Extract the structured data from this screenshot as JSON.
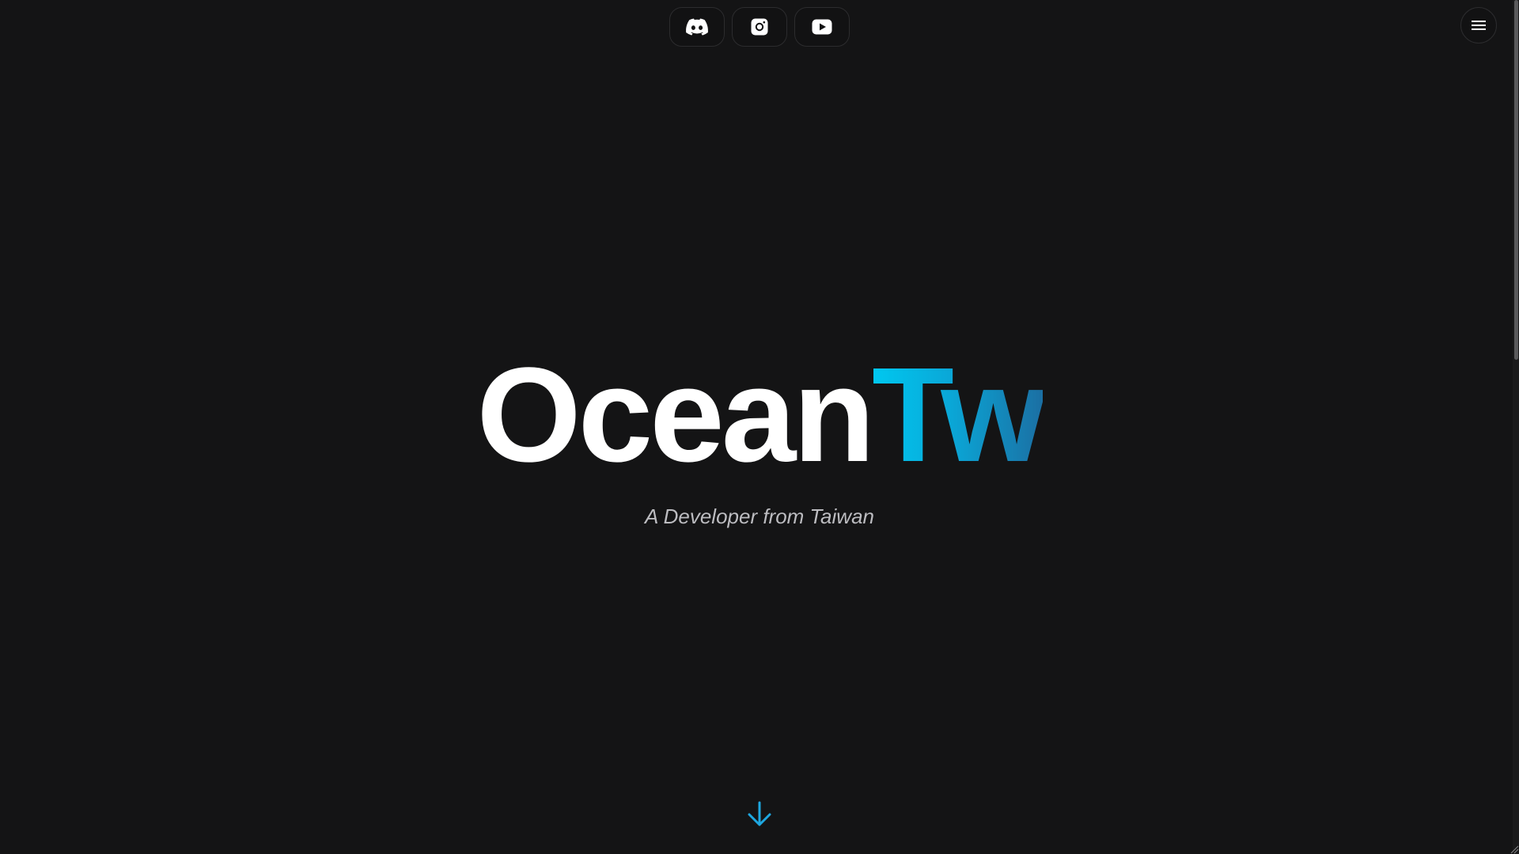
{
  "social": {
    "items": [
      {
        "name": "discord",
        "icon": "discord-icon"
      },
      {
        "name": "instagram",
        "icon": "instagram-icon"
      },
      {
        "name": "youtube",
        "icon": "youtube-icon"
      }
    ]
  },
  "menu": {
    "icon": "hamburger-menu-icon"
  },
  "hero": {
    "title_main": "Ocean",
    "title_accent": "Tw",
    "subtitle": "A Developer from Taiwan"
  },
  "scroll": {
    "icon": "arrow-down-icon"
  },
  "colors": {
    "background": "#141415",
    "accent_start": "#00c8f0",
    "accent_end": "#1b6fa3",
    "arrow": "#1ea7e0",
    "subtitle": "#bcbcc0"
  }
}
